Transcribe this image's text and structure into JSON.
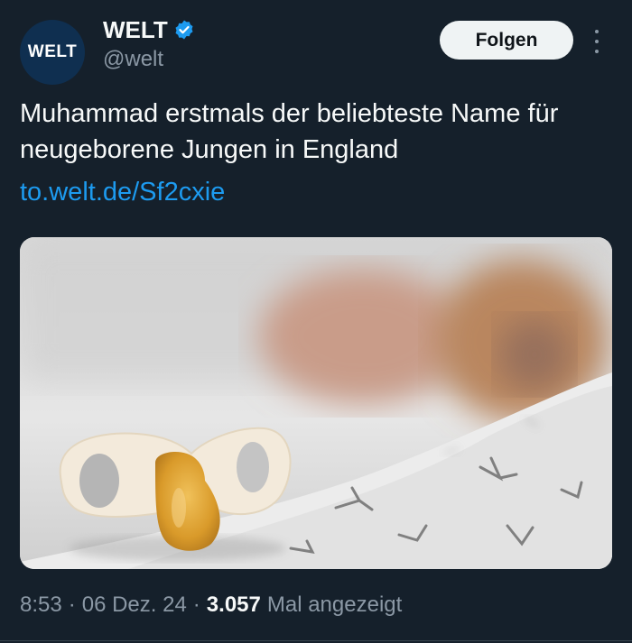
{
  "author": {
    "avatar_text": "WELT",
    "name": "WELT",
    "handle": "@welt",
    "verified": true
  },
  "actions": {
    "follow_label": "Folgen",
    "more_icon": "more-vertical-icon"
  },
  "tweet": {
    "text": "Muhammad erstmals der beliebteste Name für neugeborene Jungen in England",
    "link": "to.welt.de/Sf2cxie"
  },
  "media": {
    "description_icon": "photo-pacifier-baby"
  },
  "meta": {
    "time": "8:53",
    "separator": "·",
    "date": "06 Dez. 24",
    "views_count": "3.057",
    "views_label": "Mal angezeigt"
  },
  "colors": {
    "background": "#15202b",
    "link": "#1d9bf0",
    "verified": "#1d9bf0",
    "muted": "#8b98a5"
  }
}
